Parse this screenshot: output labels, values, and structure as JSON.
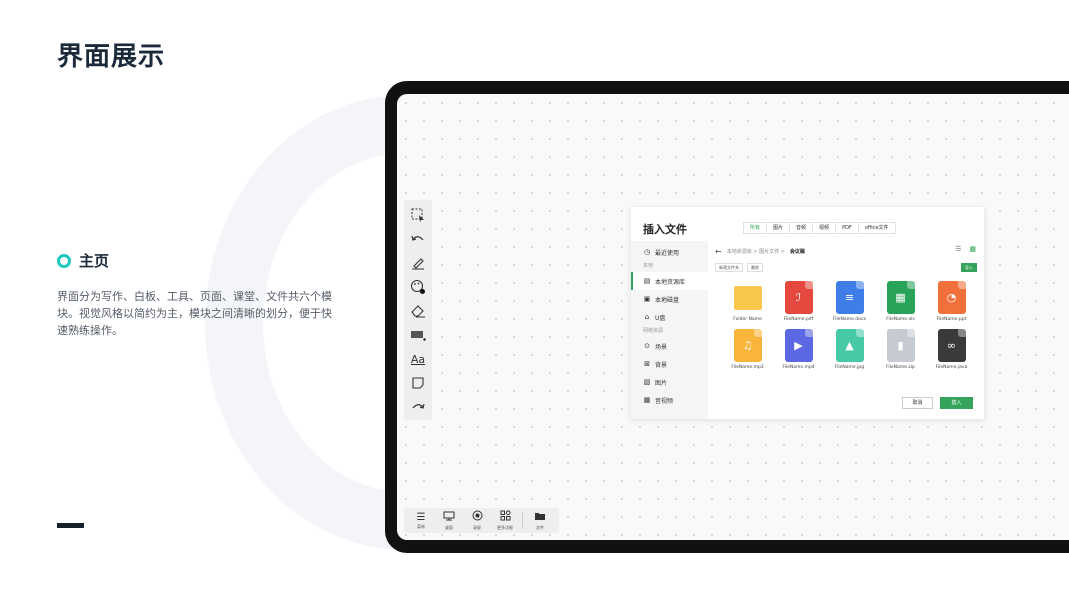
{
  "slide": {
    "title": "界面展示",
    "section_title": "主页",
    "description": "界面分为写作、白板、工具、页面、课堂、文件共六个模块。视觉风格以简约为主，模块之间清晰的划分，便于快速熟练操作。"
  },
  "left_toolbar": {
    "tools": [
      "select-icon",
      "undo-icon",
      "pen-icon",
      "palette-icon",
      "eraser-icon",
      "shape-icon",
      "text-icon",
      "note-icon",
      "redo-icon"
    ],
    "text_tool_label": "Aa"
  },
  "bottom_bar": {
    "menu_label": "菜单",
    "desktop_label": "桌面",
    "tools_label": "录屏",
    "more_label": "更多功能",
    "file_label": "文件"
  },
  "dialog": {
    "title": "插入文件",
    "tabs": [
      {
        "label": "所有",
        "active": true
      },
      {
        "label": "图片",
        "active": false
      },
      {
        "label": "音频",
        "active": false
      },
      {
        "label": "视频",
        "active": false
      },
      {
        "label": "PDF",
        "active": false
      },
      {
        "label": "office文件",
        "active": false
      }
    ],
    "sidebar": {
      "recent": "最近使用",
      "group_local": "本地",
      "local_library": "本地资源库",
      "local_disk": "本地磁盘",
      "usb": "U盘",
      "group_online": "网络资源",
      "scene": "场景",
      "background": "背景",
      "picture": "图片",
      "audio_video": "音视频"
    },
    "breadcrumb": {
      "path": "本地资源库 > 图片文件 >",
      "current": "会议稿"
    },
    "actions": {
      "new_folder": "新建文件夹",
      "delete": "删除",
      "import": "导入"
    },
    "files": [
      {
        "name": "Folder Name",
        "type": "folder",
        "color": "#f8c64a"
      },
      {
        "name": "FileName.pdf",
        "type": "pdf",
        "color": "#e5483f"
      },
      {
        "name": "FileName.docx",
        "type": "docx",
        "color": "#3f7ee8"
      },
      {
        "name": "FileName.xls",
        "type": "xls",
        "color": "#27a35a"
      },
      {
        "name": "FileName.ppt",
        "type": "ppt",
        "color": "#f2703b"
      },
      {
        "name": "FileName.mp3",
        "type": "mp3",
        "color": "#f8b53a"
      },
      {
        "name": "FileName.mp4",
        "type": "mp4",
        "color": "#5b67e3"
      },
      {
        "name": "FileName.jpg",
        "type": "jpg",
        "color": "#47c9a8"
      },
      {
        "name": "FileName.zip",
        "type": "zip",
        "color": "#c5cad3"
      },
      {
        "name": "FileName.java",
        "type": "java",
        "color": "#3a3a3a"
      }
    ],
    "cancel_label": "取消",
    "insert_label": "插入"
  },
  "colors": {
    "accent_green": "#35a35a",
    "section_ring": "#1ec8c0",
    "title": "#1b2a3a"
  }
}
